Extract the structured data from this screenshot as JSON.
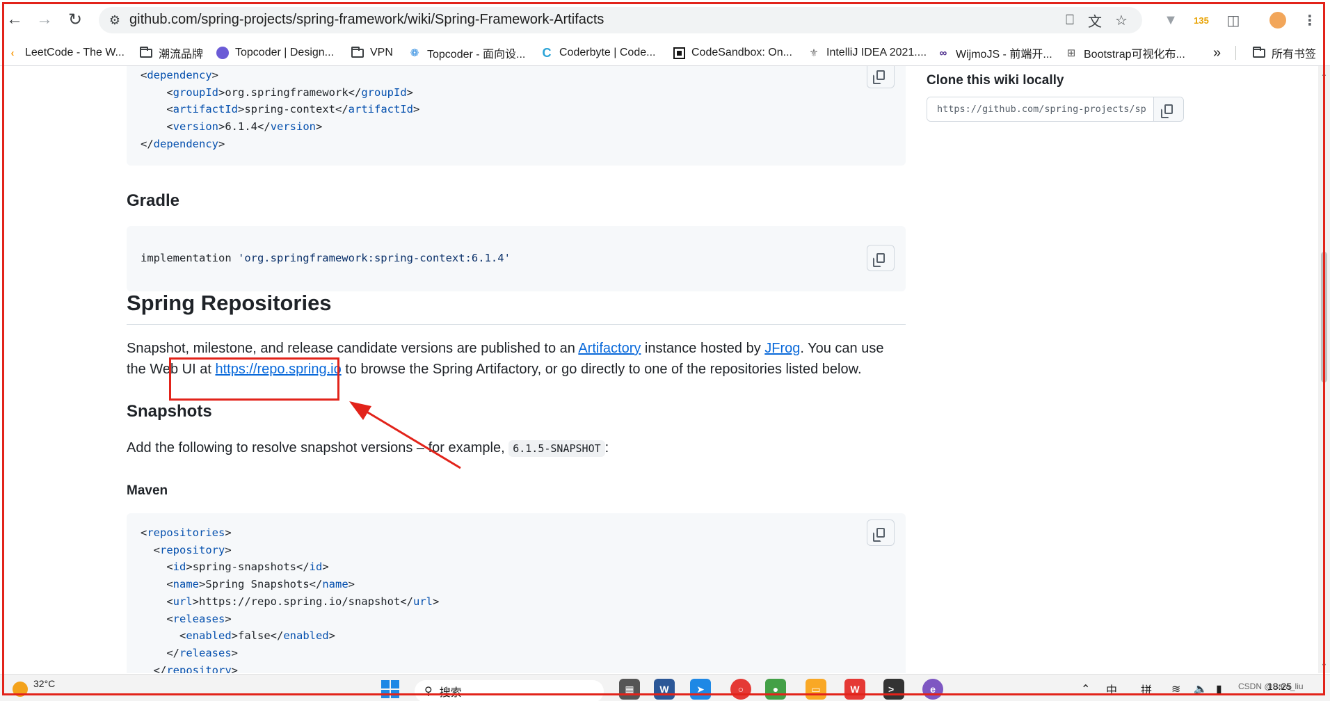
{
  "browser": {
    "url": "github.com/spring-projects/spring-framework/wiki/Spring-Framework-Artifacts",
    "bookmarks": [
      {
        "label": "LeetCode - The W...",
        "icon": "leetcode-icon"
      },
      {
        "label": "潮流品牌",
        "icon": "folder-icon"
      },
      {
        "label": "Topcoder | Design...",
        "icon": "topcoder-icon"
      },
      {
        "label": "VPN",
        "icon": "folder-icon"
      },
      {
        "label": "Topcoder - 面向设...",
        "icon": "topcoder-icon"
      },
      {
        "label": "Coderbyte | Code...",
        "icon": "coderbyte-icon"
      },
      {
        "label": "CodeSandbox: On...",
        "icon": "codesandbox-icon"
      },
      {
        "label": "IntelliJ IDEA 2021....",
        "icon": "intellij-icon"
      },
      {
        "label": "WijmoJS - 前端开...",
        "icon": "wijmo-icon"
      },
      {
        "label": "Bootstrap可视化布...",
        "icon": "bootstrap-icon"
      }
    ],
    "more_bookmarks": "»",
    "all_bookmarks": "所有书签"
  },
  "page": {
    "maven_dependency": {
      "lines": [
        {
          "indent": 0,
          "tag": "dependency",
          "open": true
        },
        {
          "indent": 1,
          "tag": "groupId",
          "value": "org.springframework"
        },
        {
          "indent": 1,
          "tag": "artifactId",
          "value": "spring-context"
        },
        {
          "indent": 1,
          "tag": "version",
          "value": "6.1.4"
        },
        {
          "indent": 0,
          "tag": "dependency",
          "close": true
        }
      ]
    },
    "gradle_heading": "Gradle",
    "gradle_code_prefix": "implementation ",
    "gradle_code_string": "'org.springframework:spring-context:6.1.4'",
    "repos_heading": "Spring Repositories",
    "repos_para": {
      "part1": "Snapshot, milestone, and release candidate versions are published to an ",
      "link1": "Artifactory",
      "part2": " instance hosted by ",
      "link2": "JFrog",
      "part3": ". You can use the Web UI at ",
      "link3": "https://repo.spring.io",
      "part4": " to browse the Spring Artifactory, or go directly to one of the repositories listed below."
    },
    "snapshots_heading": "Snapshots",
    "snapshots_para_prefix": "Add the following to resolve snapshot versions – for example, ",
    "snapshots_version": "6.1.5-SNAPSHOT",
    "snapshots_para_suffix": ":",
    "maven_heading": "Maven",
    "maven_repos": {
      "lines": [
        {
          "indent": 0,
          "tag": "repositories",
          "open": true
        },
        {
          "indent": 1,
          "tag": "repository",
          "open": true
        },
        {
          "indent": 2,
          "tag": "id",
          "value": "spring-snapshots"
        },
        {
          "indent": 2,
          "tag": "name",
          "value": "Spring Snapshots"
        },
        {
          "indent": 2,
          "tag": "url",
          "value": "https://repo.spring.io/snapshot"
        },
        {
          "indent": 2,
          "tag": "releases",
          "open": true
        },
        {
          "indent": 3,
          "tag": "enabled",
          "value": "false"
        },
        {
          "indent": 2,
          "tag": "releases",
          "close": true
        },
        {
          "indent": 1,
          "tag": "repository",
          "close": true
        }
      ]
    }
  },
  "sidebar": {
    "title": "Clone this wiki locally",
    "clone_url": "https://github.com/spring-projects/spring-framework.wiki.git"
  },
  "taskbar": {
    "weather": "32°C",
    "search_placeholder": "搜索",
    "ime1": "中",
    "ime2": "拼",
    "time": "18:25",
    "watermark": "CSDN @Sara_liu"
  },
  "colors": {
    "annotation": "#e2231a",
    "link": "#0969da",
    "xml_tag": "#0550ae"
  }
}
